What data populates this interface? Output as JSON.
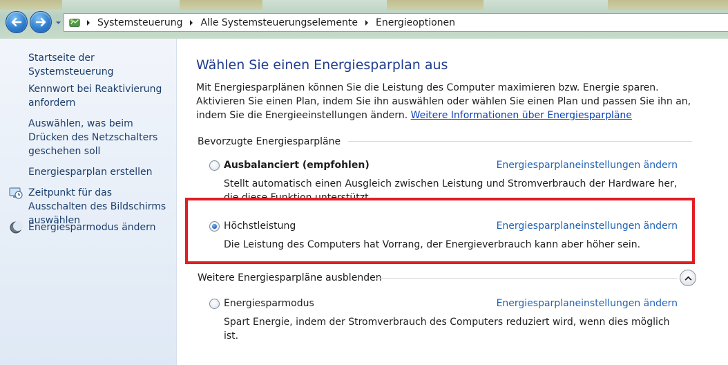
{
  "address_bar": {
    "breadcrumbs": [
      "Systemsteuerung",
      "Alle Systemsteuerungselemente",
      "Energieoptionen"
    ]
  },
  "left_pane": {
    "links": [
      "Startseite der Systemsteuerung",
      "Kennwort bei Reaktivierung anfordern",
      "Auswählen, was beim Drücken des Netzschalters geschehen soll",
      "Energiesparplan erstellen",
      "Zeitpunkt für das Ausschalten des Bildschirms auswählen",
      "Energiesparmodus ändern"
    ],
    "icons": {
      "display": "monitor-clock-icon",
      "sleep": "moon-icon"
    }
  },
  "main": {
    "title": "Wählen Sie einen Energiesparplan aus",
    "intro_text": "Mit Energiesparplänen können Sie die Leistung des Computer maximieren bzw. Energie sparen. Aktivieren Sie einen Plan, indem Sie ihn auswählen oder wählen Sie einen Plan und passen Sie ihn an, indem Sie die Energieeinstellungen ändern.",
    "intro_link": "Weitere Informationen über Energiesparpläne",
    "preferred_header": "Bevorzugte Energiesparpläne",
    "more_header": "Weitere Energiesparpläne ausblenden",
    "change_link": "Energiesparplaneinstellungen ändern",
    "plans": [
      {
        "name": "Ausbalanciert (empfohlen)",
        "description": "Stellt automatisch einen Ausgleich zwischen Leistung und Stromverbrauch der Hardware her, die diese Funktion unterstützt.",
        "selected": false
      },
      {
        "name": "Höchstleistung",
        "description": "Die Leistung des Computers hat Vorrang, der Energieverbrauch kann aber höher sein.",
        "selected": true
      },
      {
        "name": "Energiesparmodus",
        "description": "Spart Energie, indem der Stromverbrauch des Computers reduziert wird, wenn dies möglich ist.",
        "selected": false
      }
    ]
  },
  "colors": {
    "highlight": "#e01e24",
    "link": "#1f63b8",
    "title": "#1e3b8f"
  }
}
